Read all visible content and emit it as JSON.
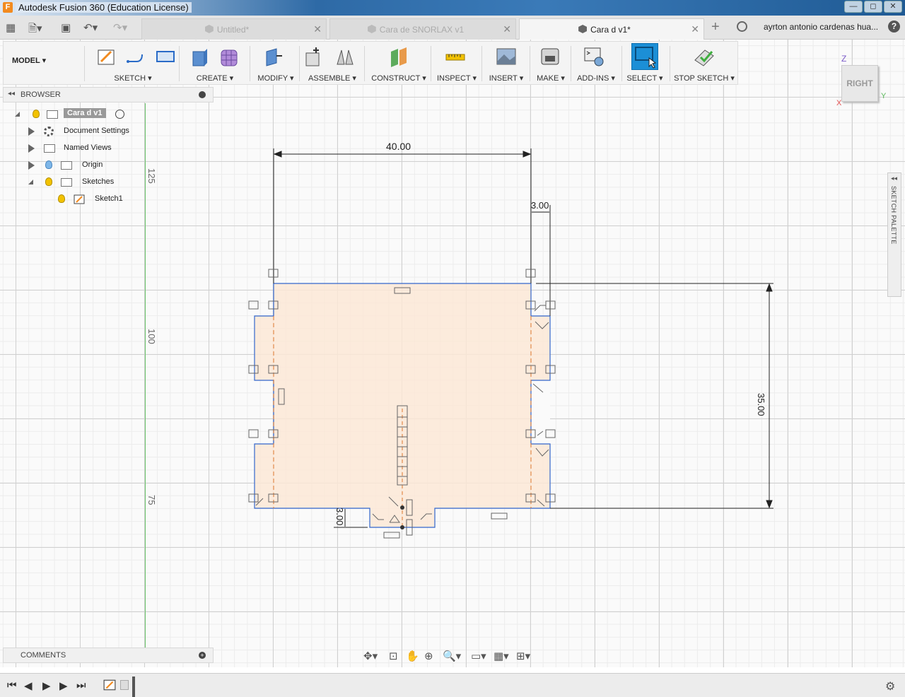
{
  "window": {
    "title": "Autodesk Fusion 360 (Education License)",
    "min": "—",
    "max": "◻",
    "close": "✕"
  },
  "tabs": [
    {
      "label": "Untitled*"
    },
    {
      "label": "Cara de SNORLAX v1"
    },
    {
      "label": "Cara d v1*"
    }
  ],
  "user": {
    "name": "ayrton antonio cardenas hua..."
  },
  "help": "?",
  "workspace": {
    "label": "MODEL"
  },
  "toolbar": {
    "groups": [
      {
        "label": "SKETCH ▾"
      },
      {
        "label": "CREATE ▾"
      },
      {
        "label": "MODIFY ▾"
      },
      {
        "label": "ASSEMBLE ▾"
      },
      {
        "label": "CONSTRUCT ▾"
      },
      {
        "label": "INSPECT ▾"
      },
      {
        "label": "INSERT ▾"
      },
      {
        "label": "MAKE ▾"
      },
      {
        "label": "ADD-INS ▾"
      },
      {
        "label": "SELECT ▾"
      },
      {
        "label": "STOP SKETCH ▾"
      }
    ]
  },
  "browser": {
    "title": "BROWSER",
    "root": "Cara d v1",
    "items": [
      {
        "label": "Document Settings"
      },
      {
        "label": "Named Views"
      },
      {
        "label": "Origin"
      },
      {
        "label": "Sketches"
      },
      {
        "label": "Sketch1"
      }
    ]
  },
  "comments": {
    "title": "COMMENTS"
  },
  "viewcube": {
    "face": "RIGHT",
    "z": "Z",
    "x": "X",
    "y": "Y"
  },
  "palette": {
    "label": "SKETCH PALETTE"
  },
  "rulers": {
    "r125": "125",
    "r100": "100",
    "r75": "75"
  },
  "dimensions": {
    "width": "40.00",
    "height": "35.00",
    "tab_offset": "3.00",
    "tab_depth": "3.00"
  },
  "colors": {
    "sketch_fill": "#fbe7d6",
    "sketch_line": "#3366cc",
    "accent": "#1c8fd6",
    "axis": "#6cc56c"
  }
}
